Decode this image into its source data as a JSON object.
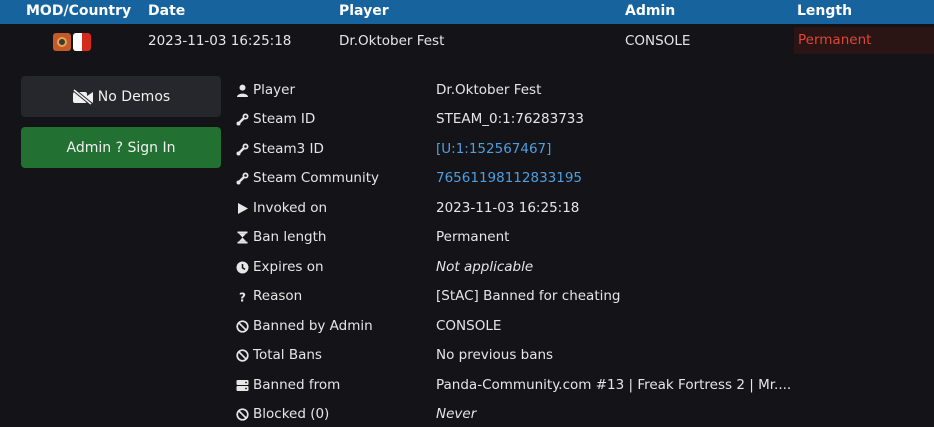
{
  "header": {
    "mod_country": "MOD/Country",
    "date": "Date",
    "player": "Player",
    "admin": "Admin",
    "length": "Length"
  },
  "ban_row": {
    "date": "2023-11-03 16:25:18",
    "player": "Dr.Oktober Fest",
    "admin": "CONSOLE",
    "length": "Permanent",
    "mod_icon": "tf2-icon",
    "flag_colors": [
      "#ffffff",
      "#d52b1e"
    ]
  },
  "buttons": {
    "demos": "No Demos",
    "admin_sign_in": "Admin ? Sign In"
  },
  "details": [
    {
      "icon": "user-icon",
      "label": "Player",
      "value": "Dr.Oktober Fest",
      "style": "normal"
    },
    {
      "icon": "steam-icon",
      "label": "Steam ID",
      "value": "STEAM_0:1:76283733",
      "style": "normal"
    },
    {
      "icon": "steam-icon",
      "label": "Steam3 ID",
      "value": "[U:1:152567467]",
      "style": "link"
    },
    {
      "icon": "steam-icon",
      "label": "Steam Community",
      "value": "76561198112833195",
      "style": "link"
    },
    {
      "icon": "play-icon",
      "label": "Invoked on",
      "value": "2023-11-03 16:25:18",
      "style": "normal"
    },
    {
      "icon": "hourglass-icon",
      "label": "Ban length",
      "value": "Permanent",
      "style": "normal"
    },
    {
      "icon": "clock-icon",
      "label": "Expires on",
      "value": "Not applicable",
      "style": "italic"
    },
    {
      "icon": "question-icon",
      "label": "Reason",
      "value": "[StAC] Banned for cheating",
      "style": "normal"
    },
    {
      "icon": "ban-icon",
      "label": "Banned by Admin",
      "value": "CONSOLE",
      "style": "normal"
    },
    {
      "icon": "ban-icon",
      "label": "Total Bans",
      "value": "No previous bans",
      "style": "normal"
    },
    {
      "icon": "server-icon",
      "label": "Banned from",
      "value": "Panda-Community.com #13 | Freak Fortress 2 | Mr....",
      "style": "normal"
    },
    {
      "icon": "ban-icon",
      "label": "Blocked (0)",
      "value": "Never",
      "style": "italic"
    }
  ],
  "colors": {
    "header_bg": "#16639e",
    "page_bg": "#141418",
    "link": "#4d9fe0",
    "permanent": "#d9483b",
    "admin_button": "#237033"
  }
}
